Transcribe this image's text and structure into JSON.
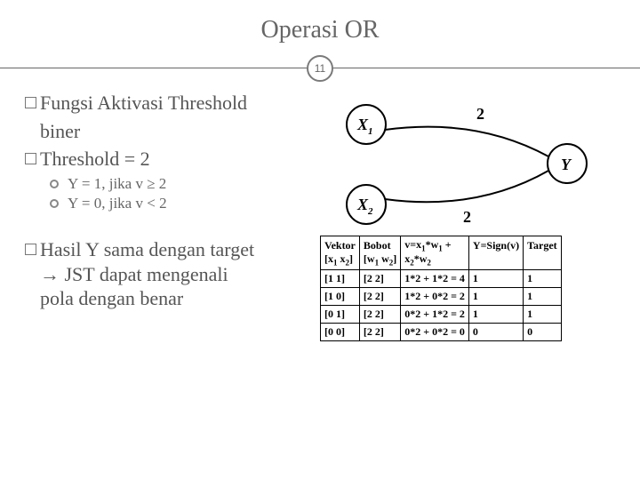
{
  "slide_number": "11",
  "title": "Operasi OR",
  "bullets": {
    "b1_line1": "Fungsi Aktivasi Threshold",
    "b1_line2": "biner",
    "b2": "Threshold = 2",
    "sub1": "Y = 1, jika v ≥ 2",
    "sub2": "Y = 0, jika v < 2",
    "b3_line1": "Hasil Y sama dengan target",
    "b3_line2": "→ JST dapat mengenali",
    "b3_line3": "pola dengan benar"
  },
  "diagram": {
    "nodes": {
      "x1": "X",
      "x1_sub": "1",
      "x2": "X",
      "x2_sub": "2",
      "y": "Y"
    },
    "weights": {
      "w1": "2",
      "w2": "2"
    }
  },
  "table": {
    "headers": {
      "c1a": "Vektor",
      "c1b_pre": "[x",
      "c1b_s1": "1",
      "c1b_mid": " x",
      "c1b_s2": "2",
      "c1b_post": "]",
      "c2a": "Bobot",
      "c2b_pre": "[w",
      "c2b_s1": "1",
      "c2b_mid": " w",
      "c2b_s2": "2",
      "c2b_post": "]",
      "c3a_pre": "v=x",
      "c3a_s1": "1",
      "c3a_mid1": "*w",
      "c3a_s2": "1",
      "c3a_plus": " +",
      "c3b_pre": "x",
      "c3b_s1": "2",
      "c3b_mid": "*w",
      "c3b_s2": "2",
      "c4": "Y=Sign(v)",
      "c5": "Target"
    },
    "rows": [
      {
        "vec": "[1 1]",
        "bob": "[2 2]",
        "v": "1*2 + 1*2 = 4",
        "y": "1",
        "t": "1"
      },
      {
        "vec": "[1 0]",
        "bob": "[2 2]",
        "v": "1*2 + 0*2 = 2",
        "y": "1",
        "t": "1"
      },
      {
        "vec": "[0 1]",
        "bob": "[2 2]",
        "v": "0*2 + 1*2 = 2",
        "y": "1",
        "t": "1"
      },
      {
        "vec": "[0 0]",
        "bob": "[2 2]",
        "v": "0*2 + 0*2 = 0",
        "y": "0",
        "t": "0"
      }
    ]
  }
}
